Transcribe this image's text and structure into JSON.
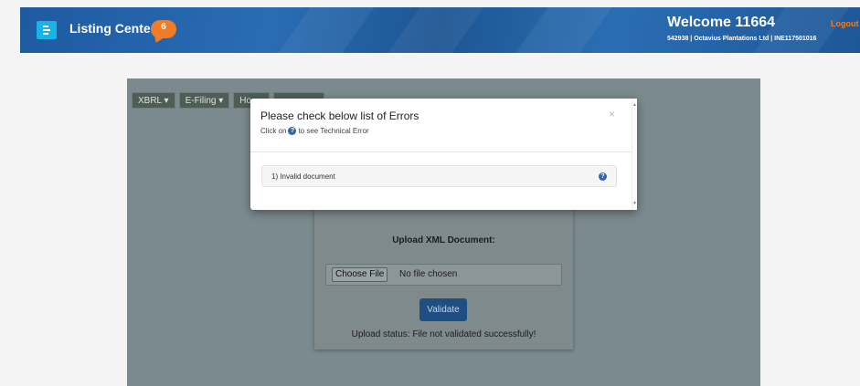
{
  "header": {
    "app_title": "Listing Center",
    "notification_count": "6",
    "welcome": "Welcome 11664",
    "logout_label": "Logout",
    "company_line": "542938 | Octavius Plantations Ltd | INE117501016"
  },
  "nav": {
    "items": [
      {
        "label": "XBRL ▾"
      },
      {
        "label": "E-Filing ▾"
      },
      {
        "label": "Ho"
      },
      {
        "label": ""
      }
    ]
  },
  "upload": {
    "title": "Upload XML Document:",
    "choose_label": "Choose File",
    "no_file": "No file chosen",
    "validate_label": "Validate",
    "status": "Upload status: File not validated successfully!"
  },
  "modal": {
    "title": "Please check below list of Errors",
    "subtitle_prefix": "Click on",
    "subtitle_suffix": "to see Technical Error",
    "close_glyph": "×",
    "errors": [
      {
        "text": "1) Invalid document"
      }
    ]
  },
  "colors": {
    "header": "#1e5aa0",
    "accent_orange": "#f07d26",
    "menu_button": "#18b4e8",
    "validate_button": "#1f4f82",
    "help_icon": "#2f66b3"
  }
}
